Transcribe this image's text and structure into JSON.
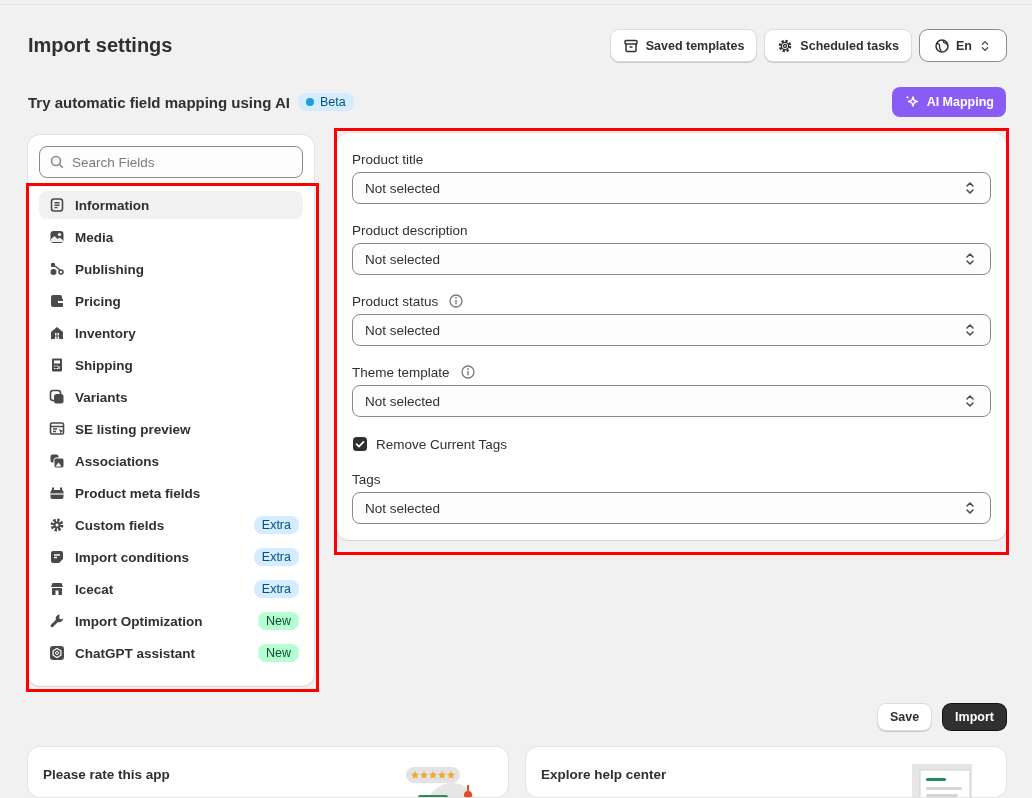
{
  "page": {
    "title": "Import settings"
  },
  "header_buttons": [
    {
      "kind": "templates",
      "label": "Saved templates"
    },
    {
      "kind": "tasks",
      "label": "Scheduled tasks"
    },
    {
      "kind": "language",
      "label": "En"
    }
  ],
  "ai_banner": {
    "text": "Try automatic field mapping using AI",
    "badge": {
      "label": "Beta",
      "color": "#1a9ee0"
    },
    "button": "AI Mapping"
  },
  "sidebar": {
    "search": {
      "placeholder": "Search Fields"
    },
    "highlighted": true,
    "items": [
      {
        "label": "Information",
        "selected": true
      },
      {
        "label": "Media",
        "selected": false
      },
      {
        "label": "Publishing",
        "selected": false
      },
      {
        "label": "Pricing",
        "selected": false
      },
      {
        "label": "Inventory",
        "selected": false
      },
      {
        "label": "Shipping",
        "selected": false
      },
      {
        "label": "Variants",
        "selected": false
      },
      {
        "label": "SE listing preview",
        "selected": false
      },
      {
        "label": "Associations",
        "selected": false
      },
      {
        "label": "Product meta fields",
        "selected": false
      },
      {
        "label": "Custom fields",
        "selected": false,
        "badge": {
          "label": "Extra",
          "kind": "extra"
        }
      },
      {
        "label": "Import conditions",
        "selected": false,
        "badge": {
          "label": "Extra",
          "kind": "extra"
        }
      },
      {
        "label": "Icecat",
        "selected": false,
        "badge": {
          "label": "Extra",
          "kind": "extra"
        }
      },
      {
        "label": "Import Optimization",
        "selected": false,
        "badge": {
          "label": "New",
          "kind": "new"
        }
      },
      {
        "label": "ChatGPT assistant",
        "selected": false,
        "badge": {
          "label": "New",
          "kind": "new"
        }
      }
    ]
  },
  "form": {
    "highlighted": true,
    "fields": [
      {
        "kind": "select",
        "label": "Product title",
        "info": false,
        "value": "Not selected"
      },
      {
        "kind": "select",
        "label": "Product description",
        "info": false,
        "value": "Not selected"
      },
      {
        "kind": "select",
        "label": "Product status",
        "info": true,
        "value": "Not selected"
      },
      {
        "kind": "select",
        "label": "Theme template",
        "info": true,
        "value": "Not selected"
      },
      {
        "kind": "checkbox",
        "label": "Remove Current Tags",
        "checked": true
      },
      {
        "kind": "select",
        "label": "Tags",
        "info": false,
        "value": "Not selected"
      }
    ]
  },
  "actions": [
    {
      "kind": "secondary",
      "label": "Save"
    },
    {
      "kind": "primary",
      "label": "Import"
    }
  ],
  "cards": [
    {
      "kind": "rate",
      "title": "Please rate this app"
    },
    {
      "kind": "help",
      "title": "Explore help center"
    }
  ]
}
